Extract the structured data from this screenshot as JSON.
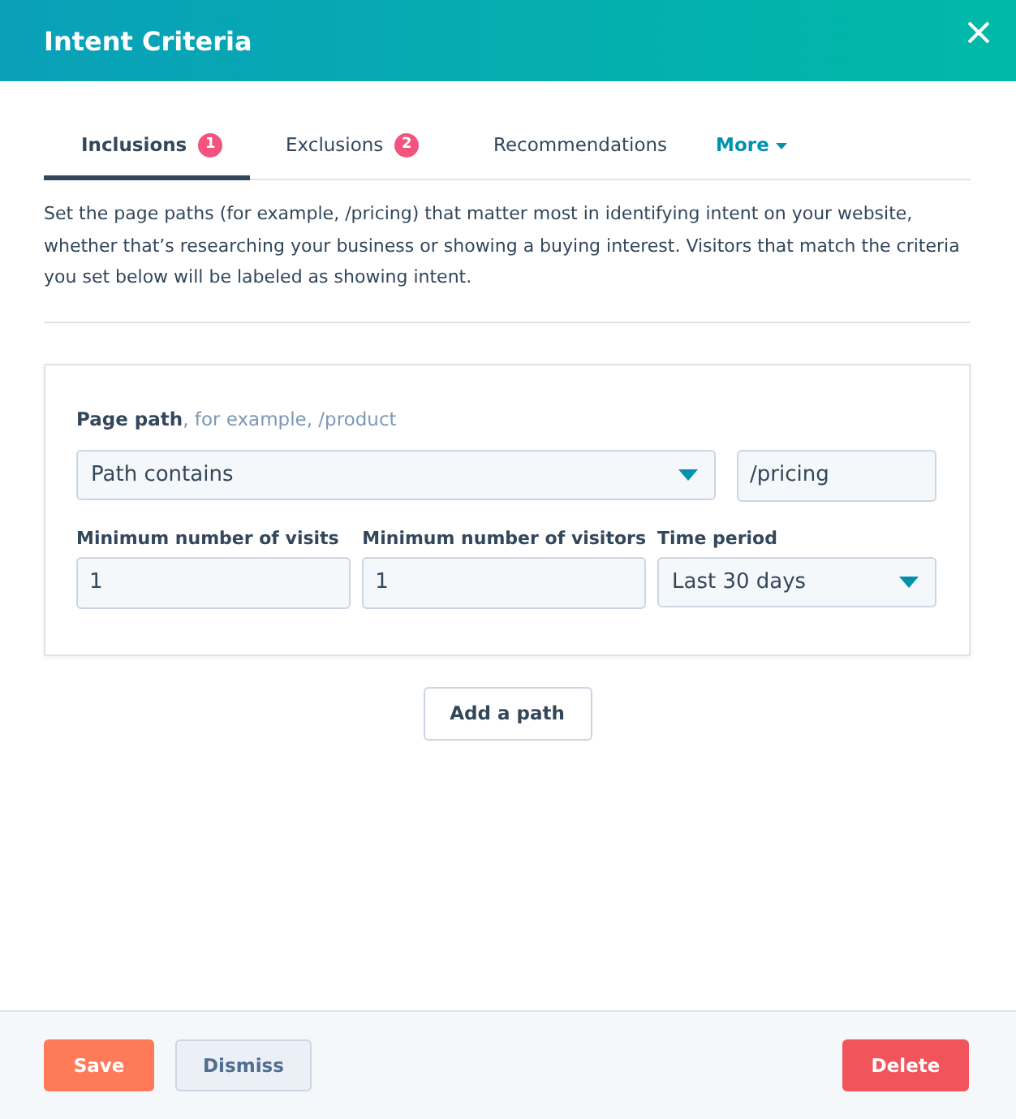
{
  "dialog": {
    "title": "Intent Criteria"
  },
  "tabs": [
    {
      "label": "Inclusions",
      "badge": "1",
      "kind": "tab",
      "selected": true
    },
    {
      "label": "Exclusions",
      "badge": "2",
      "kind": "tab",
      "selected": false
    },
    {
      "label": "Recommendations",
      "kind": "tab",
      "selected": false
    },
    {
      "label": "More",
      "kind": "dropdown",
      "selected": false
    }
  ],
  "description": "Set the page paths (for example, /pricing) that matter most in identifying intent on your website, whether that’s researching your business or showing a buying interest. Visitors that match the criteria you set below will be labeled as showing intent.",
  "path_card": {
    "label": "Page path",
    "hint": ", for example, /product",
    "match_type": {
      "value": "Path contains"
    },
    "path": {
      "value": "/pricing"
    },
    "fields": [
      {
        "label": "Minimum number of visits",
        "value": "1",
        "kind": "input"
      },
      {
        "label": "Minimum number of visitors",
        "value": "1",
        "kind": "input"
      },
      {
        "label": "Time period",
        "value": "Last 30 days",
        "kind": "select"
      }
    ]
  },
  "add_button": "Add a path",
  "footer": {
    "buttons": [
      {
        "label": "Save",
        "kind": "primary"
      },
      {
        "label": "Dismiss",
        "kind": "secondary"
      },
      {
        "label": "Delete",
        "kind": "danger"
      }
    ]
  }
}
